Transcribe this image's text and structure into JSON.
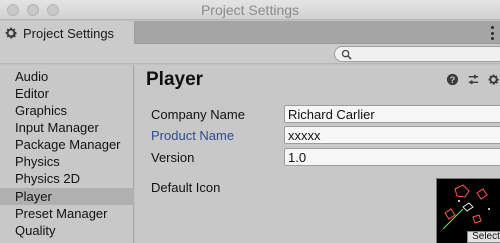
{
  "window": {
    "title": "Project Settings"
  },
  "tab": {
    "label": "Project Settings",
    "icon": "gear-icon"
  },
  "search": {
    "placeholder": "",
    "value": ""
  },
  "sidebar": {
    "items": [
      {
        "label": "Audio",
        "selected": false
      },
      {
        "label": "Editor",
        "selected": false
      },
      {
        "label": "Graphics",
        "selected": false
      },
      {
        "label": "Input Manager",
        "selected": false
      },
      {
        "label": "Package Manager",
        "selected": false
      },
      {
        "label": "Physics",
        "selected": false
      },
      {
        "label": "Physics 2D",
        "selected": false
      },
      {
        "label": "Player",
        "selected": true
      },
      {
        "label": "Preset Manager",
        "selected": false
      },
      {
        "label": "Quality",
        "selected": false
      }
    ]
  },
  "main": {
    "title": "Player",
    "header_icons": [
      "help-icon",
      "presets-icon",
      "settings-icon"
    ],
    "fields": {
      "company_label": "Company Name",
      "company_value": "Richard Carlier",
      "product_label": "Product Name",
      "product_value": "xxxxx",
      "version_label": "Version",
      "version_value": "1.0"
    },
    "default_icon_label": "Default Icon",
    "select_label": "Select"
  },
  "colors": {
    "highlight_label": "#2a4d8f",
    "panel_bg": "#c8c8c8",
    "selected_item_bg": "#b0b0b0"
  }
}
